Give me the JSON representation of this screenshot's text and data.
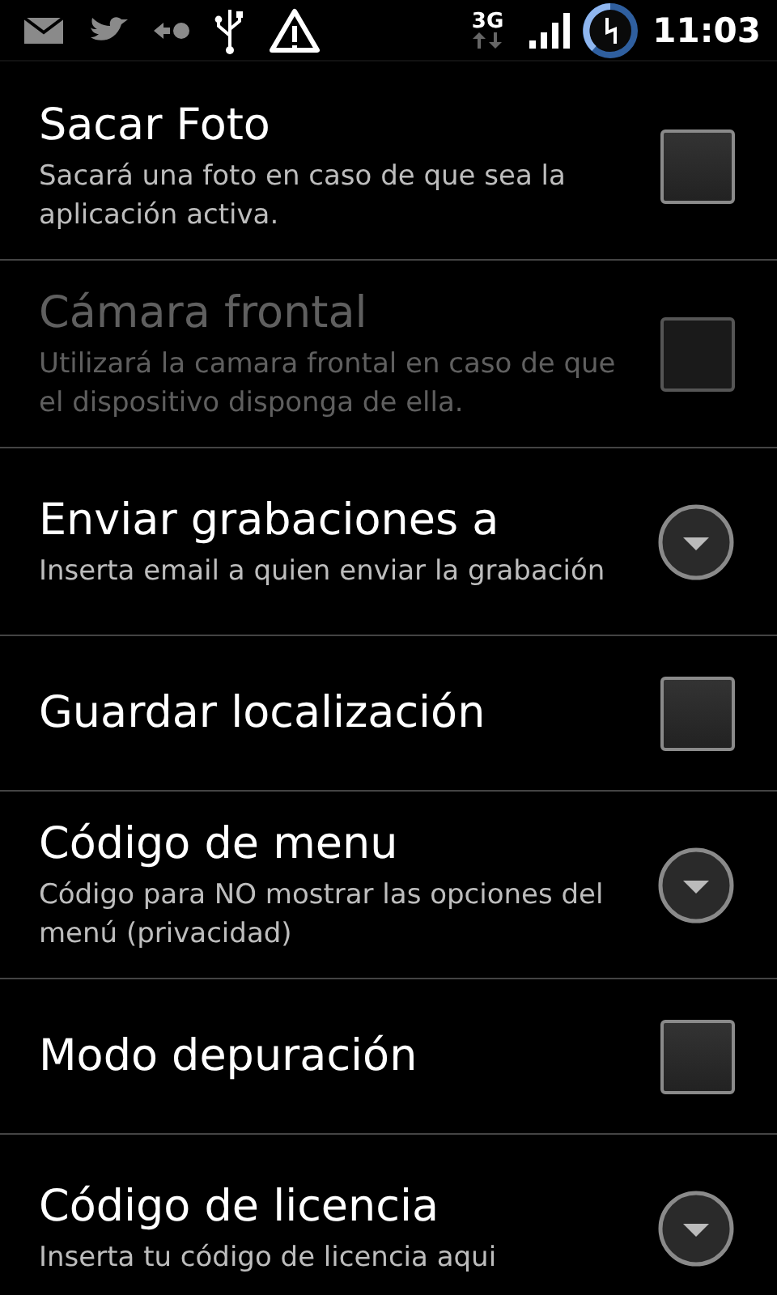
{
  "status_bar": {
    "network": "3G",
    "time": "11:03"
  },
  "preferences": [
    {
      "kind": "checkbox",
      "title": "Sacar Foto",
      "summary": "Sacará una foto en caso de que sea la aplicación activa.",
      "enabled": true,
      "checked": false
    },
    {
      "kind": "checkbox",
      "title": "Cámara frontal",
      "summary": "Utilizará la camara frontal en caso de que el dispositivo disponga de ella.",
      "enabled": false,
      "checked": false
    },
    {
      "kind": "list",
      "title": "Enviar grabaciones a",
      "summary": "Inserta email a quien enviar la grabación",
      "enabled": true
    },
    {
      "kind": "checkbox",
      "title": "Guardar localización",
      "enabled": true,
      "checked": false
    },
    {
      "kind": "list",
      "title": "Código de menu",
      "summary": "Código para NO mostrar las opciones del menú (privacidad)",
      "enabled": true
    },
    {
      "kind": "checkbox",
      "title": "Modo depuración",
      "enabled": true,
      "checked": false
    },
    {
      "kind": "list",
      "title": "Código de licencia",
      "summary": "Inserta tu código de licencia aqui",
      "enabled": true
    }
  ]
}
